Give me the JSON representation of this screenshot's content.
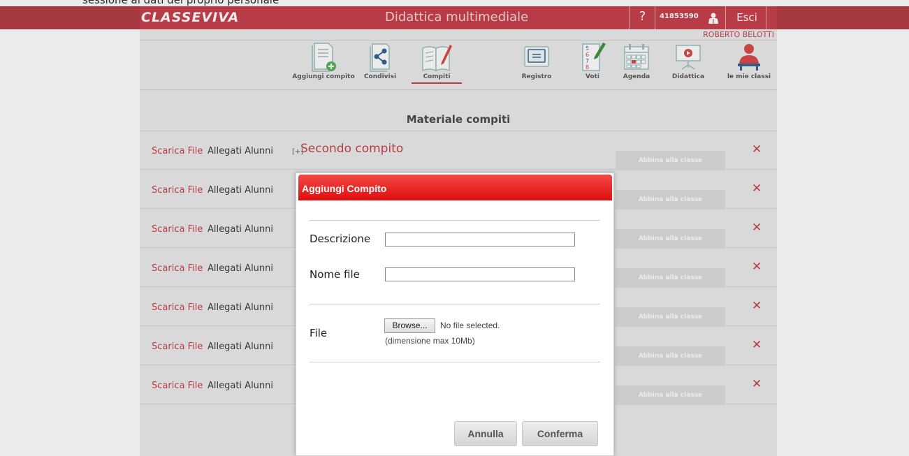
{
  "page": {
    "top_caption": "sessione ai dati del proprio personale"
  },
  "header": {
    "logo": "CLASSEVIVA",
    "title": "Didattica multimediale",
    "help_label": "?",
    "user_code": "41853590",
    "logout_label": "Esci",
    "user_name": "ROBERTO BELOTTI",
    "colors": {
      "bar": "#b23540",
      "brand": "#c43845"
    }
  },
  "nav": {
    "items": [
      {
        "label": "Aggiungi compito",
        "icon": "add-task-icon"
      },
      {
        "label": "Condivisi",
        "icon": "share-icon"
      },
      {
        "label": "Compiti",
        "icon": "book-pen-icon",
        "active": true
      },
      {
        "label": "Registro",
        "icon": "register-icon"
      },
      {
        "label": "Voti",
        "icon": "grades-icon"
      },
      {
        "label": "Agenda",
        "icon": "calendar-icon"
      },
      {
        "label": "Didattica",
        "icon": "presentation-icon"
      },
      {
        "label": "le mie classi",
        "icon": "user-icon"
      }
    ]
  },
  "section": {
    "title": "Materiale compiti"
  },
  "rows": [
    {
      "download": "Scarica File",
      "attachments": "Allegati Alunni",
      "expand": "[+]",
      "title": "Secondo compito",
      "assign": "Abbina alla classe",
      "delete": "✕"
    },
    {
      "download": "Scarica File",
      "attachments": "Allegati Alunni",
      "assign": "Abbina alla classe",
      "delete": "✕"
    },
    {
      "download": "Scarica File",
      "attachments": "Allegati Alunni",
      "assign": "Abbina alla classe",
      "delete": "✕"
    },
    {
      "download": "Scarica File",
      "attachments": "Allegati Alunni",
      "assign": "Abbina alla classe",
      "delete": "✕"
    },
    {
      "download": "Scarica File",
      "attachments": "Allegati Alunni",
      "assign": "Abbina alla classe",
      "delete": "✕"
    },
    {
      "download": "Scarica File",
      "attachments": "Allegati Alunni",
      "assign": "Abbina alla classe",
      "delete": "✕"
    },
    {
      "download": "Scarica File",
      "attachments": "Allegati Alunni",
      "assign": "Abbina alla classe",
      "delete": "✕"
    }
  ],
  "dialog": {
    "title": "Aggiungi Compito",
    "description_label": "Descrizione",
    "description_value": "",
    "filename_label": "Nome file",
    "filename_value": "",
    "file_label": "File",
    "browse_label": "Browse...",
    "no_file_text": "No file selected.",
    "max_size_text": "(dimensione max 10Mb)",
    "cancel_label": "Annulla",
    "confirm_label": "Conferma",
    "colors": {
      "header": "#e00d0d"
    }
  }
}
